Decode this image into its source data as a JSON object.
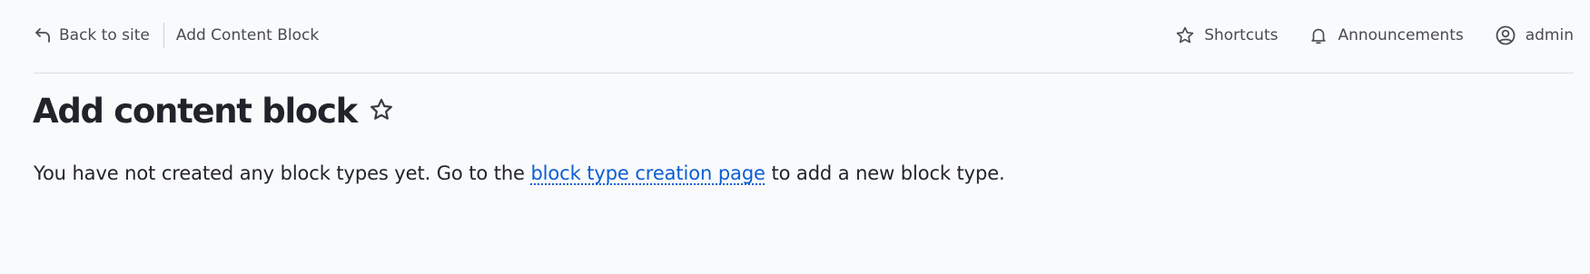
{
  "toolbar": {
    "back_label": "Back to site",
    "breadcrumb": "Add Content Block",
    "shortcuts_label": "Shortcuts",
    "announcements_label": "Announcements",
    "user_label": "admin"
  },
  "page": {
    "title": "Add content block"
  },
  "message": {
    "before": "You have not created any block types yet. Go to the ",
    "link_text": "block type creation page",
    "after": " to add a new block type."
  },
  "colors": {
    "link": "#0b5ed4",
    "text": "#232429",
    "background": "#f9fafc"
  },
  "icons": {
    "back": "return-arrow-icon",
    "shortcuts": "star-icon",
    "announcements": "bell-icon",
    "user": "user-circle-icon",
    "title_shortcut": "star-outline-icon"
  }
}
